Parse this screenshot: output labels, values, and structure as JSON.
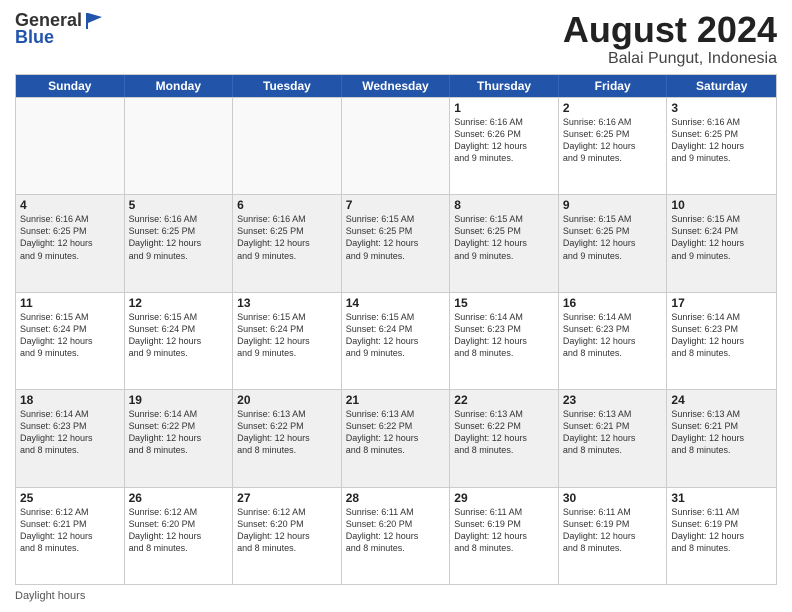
{
  "header": {
    "logo_general": "General",
    "logo_blue": "Blue",
    "month_year": "August 2024",
    "location": "Balai Pungut, Indonesia"
  },
  "weekdays": [
    "Sunday",
    "Monday",
    "Tuesday",
    "Wednesday",
    "Thursday",
    "Friday",
    "Saturday"
  ],
  "footer": {
    "daylight_label": "Daylight hours"
  },
  "weeks": [
    [
      {
        "day": "",
        "info": "",
        "empty": true
      },
      {
        "day": "",
        "info": "",
        "empty": true
      },
      {
        "day": "",
        "info": "",
        "empty": true
      },
      {
        "day": "",
        "info": "",
        "empty": true
      },
      {
        "day": "1",
        "info": "Sunrise: 6:16 AM\nSunset: 6:26 PM\nDaylight: 12 hours\nand 9 minutes.",
        "empty": false
      },
      {
        "day": "2",
        "info": "Sunrise: 6:16 AM\nSunset: 6:25 PM\nDaylight: 12 hours\nand 9 minutes.",
        "empty": false
      },
      {
        "day": "3",
        "info": "Sunrise: 6:16 AM\nSunset: 6:25 PM\nDaylight: 12 hours\nand 9 minutes.",
        "empty": false
      }
    ],
    [
      {
        "day": "4",
        "info": "Sunrise: 6:16 AM\nSunset: 6:25 PM\nDaylight: 12 hours\nand 9 minutes.",
        "empty": false
      },
      {
        "day": "5",
        "info": "Sunrise: 6:16 AM\nSunset: 6:25 PM\nDaylight: 12 hours\nand 9 minutes.",
        "empty": false
      },
      {
        "day": "6",
        "info": "Sunrise: 6:16 AM\nSunset: 6:25 PM\nDaylight: 12 hours\nand 9 minutes.",
        "empty": false
      },
      {
        "day": "7",
        "info": "Sunrise: 6:15 AM\nSunset: 6:25 PM\nDaylight: 12 hours\nand 9 minutes.",
        "empty": false
      },
      {
        "day": "8",
        "info": "Sunrise: 6:15 AM\nSunset: 6:25 PM\nDaylight: 12 hours\nand 9 minutes.",
        "empty": false
      },
      {
        "day": "9",
        "info": "Sunrise: 6:15 AM\nSunset: 6:25 PM\nDaylight: 12 hours\nand 9 minutes.",
        "empty": false
      },
      {
        "day": "10",
        "info": "Sunrise: 6:15 AM\nSunset: 6:24 PM\nDaylight: 12 hours\nand 9 minutes.",
        "empty": false
      }
    ],
    [
      {
        "day": "11",
        "info": "Sunrise: 6:15 AM\nSunset: 6:24 PM\nDaylight: 12 hours\nand 9 minutes.",
        "empty": false
      },
      {
        "day": "12",
        "info": "Sunrise: 6:15 AM\nSunset: 6:24 PM\nDaylight: 12 hours\nand 9 minutes.",
        "empty": false
      },
      {
        "day": "13",
        "info": "Sunrise: 6:15 AM\nSunset: 6:24 PM\nDaylight: 12 hours\nand 9 minutes.",
        "empty": false
      },
      {
        "day": "14",
        "info": "Sunrise: 6:15 AM\nSunset: 6:24 PM\nDaylight: 12 hours\nand 9 minutes.",
        "empty": false
      },
      {
        "day": "15",
        "info": "Sunrise: 6:14 AM\nSunset: 6:23 PM\nDaylight: 12 hours\nand 8 minutes.",
        "empty": false
      },
      {
        "day": "16",
        "info": "Sunrise: 6:14 AM\nSunset: 6:23 PM\nDaylight: 12 hours\nand 8 minutes.",
        "empty": false
      },
      {
        "day": "17",
        "info": "Sunrise: 6:14 AM\nSunset: 6:23 PM\nDaylight: 12 hours\nand 8 minutes.",
        "empty": false
      }
    ],
    [
      {
        "day": "18",
        "info": "Sunrise: 6:14 AM\nSunset: 6:23 PM\nDaylight: 12 hours\nand 8 minutes.",
        "empty": false
      },
      {
        "day": "19",
        "info": "Sunrise: 6:14 AM\nSunset: 6:22 PM\nDaylight: 12 hours\nand 8 minutes.",
        "empty": false
      },
      {
        "day": "20",
        "info": "Sunrise: 6:13 AM\nSunset: 6:22 PM\nDaylight: 12 hours\nand 8 minutes.",
        "empty": false
      },
      {
        "day": "21",
        "info": "Sunrise: 6:13 AM\nSunset: 6:22 PM\nDaylight: 12 hours\nand 8 minutes.",
        "empty": false
      },
      {
        "day": "22",
        "info": "Sunrise: 6:13 AM\nSunset: 6:22 PM\nDaylight: 12 hours\nand 8 minutes.",
        "empty": false
      },
      {
        "day": "23",
        "info": "Sunrise: 6:13 AM\nSunset: 6:21 PM\nDaylight: 12 hours\nand 8 minutes.",
        "empty": false
      },
      {
        "day": "24",
        "info": "Sunrise: 6:13 AM\nSunset: 6:21 PM\nDaylight: 12 hours\nand 8 minutes.",
        "empty": false
      }
    ],
    [
      {
        "day": "25",
        "info": "Sunrise: 6:12 AM\nSunset: 6:21 PM\nDaylight: 12 hours\nand 8 minutes.",
        "empty": false
      },
      {
        "day": "26",
        "info": "Sunrise: 6:12 AM\nSunset: 6:20 PM\nDaylight: 12 hours\nand 8 minutes.",
        "empty": false
      },
      {
        "day": "27",
        "info": "Sunrise: 6:12 AM\nSunset: 6:20 PM\nDaylight: 12 hours\nand 8 minutes.",
        "empty": false
      },
      {
        "day": "28",
        "info": "Sunrise: 6:11 AM\nSunset: 6:20 PM\nDaylight: 12 hours\nand 8 minutes.",
        "empty": false
      },
      {
        "day": "29",
        "info": "Sunrise: 6:11 AM\nSunset: 6:19 PM\nDaylight: 12 hours\nand 8 minutes.",
        "empty": false
      },
      {
        "day": "30",
        "info": "Sunrise: 6:11 AM\nSunset: 6:19 PM\nDaylight: 12 hours\nand 8 minutes.",
        "empty": false
      },
      {
        "day": "31",
        "info": "Sunrise: 6:11 AM\nSunset: 6:19 PM\nDaylight: 12 hours\nand 8 minutes.",
        "empty": false
      }
    ]
  ]
}
